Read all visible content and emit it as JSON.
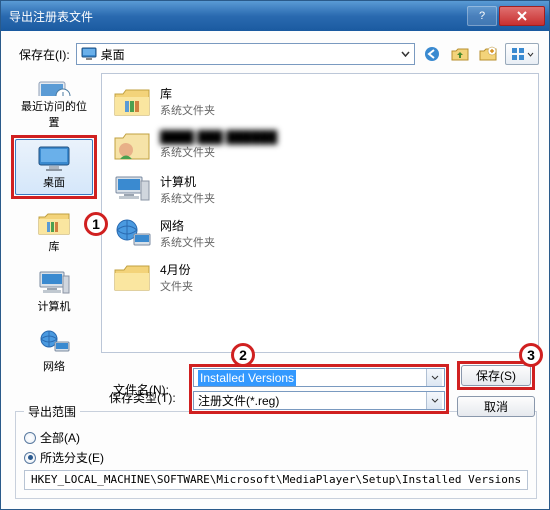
{
  "window": {
    "title": "导出注册表文件"
  },
  "toolbar": {
    "savein_label": "保存在(I):",
    "savein_value": "桌面"
  },
  "sidebar": [
    {
      "id": "recent",
      "label": "最近访问的位置",
      "icon": "recent-places-icon"
    },
    {
      "id": "desktop",
      "label": "桌面",
      "icon": "desktop-icon",
      "selected": true
    },
    {
      "id": "libraries",
      "label": "库",
      "icon": "libraries-icon"
    },
    {
      "id": "computer",
      "label": "计算机",
      "icon": "computer-icon"
    },
    {
      "id": "network",
      "label": "网络",
      "icon": "network-icon"
    }
  ],
  "files": [
    {
      "name": "库",
      "sub": "系统文件夹",
      "icon": "libraries-large-icon"
    },
    {
      "name": "blurred",
      "sub": "系统文件夹",
      "icon": "user-folder-icon",
      "blurred": true
    },
    {
      "name": "计算机",
      "sub": "系统文件夹",
      "icon": "computer-large-icon"
    },
    {
      "name": "网络",
      "sub": "系统文件夹",
      "icon": "network-large-icon"
    },
    {
      "name": "4月份",
      "sub": "文件夹",
      "icon": "folder-icon"
    }
  ],
  "form": {
    "filename_label": "文件名(N):",
    "filename_value": "Installed Versions",
    "filetype_label": "保存类型(T):",
    "filetype_value": "注册文件(*.reg)",
    "save_btn": "保存(S)",
    "cancel_btn": "取消"
  },
  "export_range": {
    "legend": "导出范围",
    "all_label": "全部(A)",
    "branch_label": "所选分支(E)",
    "branch_selected": true,
    "path": "HKEY_LOCAL_MACHINE\\SOFTWARE\\Microsoft\\MediaPlayer\\Setup\\Installed Versions"
  },
  "callouts": {
    "one": "1",
    "two": "2",
    "three": "3"
  }
}
